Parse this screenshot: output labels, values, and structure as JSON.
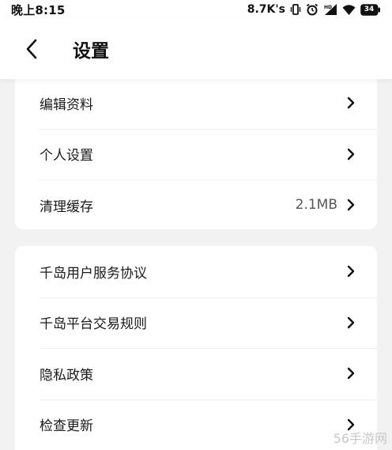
{
  "status_bar": {
    "time": "晚上8:15",
    "net_speed": "8.7K's",
    "battery_level": "34",
    "icons": [
      "vibrate-icon",
      "alarm-icon",
      "hd-signal-icon",
      "wifi-icon",
      "battery-icon"
    ]
  },
  "header": {
    "title": "设置",
    "back_icon": "chevron-left-icon"
  },
  "group_1": {
    "items": [
      {
        "label": "编辑资料",
        "value": ""
      },
      {
        "label": "个人设置",
        "value": ""
      },
      {
        "label": "清理缓存",
        "value": "2.1MB"
      }
    ]
  },
  "group_2": {
    "items": [
      {
        "label": "千岛用户服务协议",
        "value": ""
      },
      {
        "label": "千岛平台交易规则",
        "value": ""
      },
      {
        "label": "隐私政策",
        "value": ""
      },
      {
        "label": "检查更新",
        "value": ""
      }
    ]
  },
  "watermark": "56手游网",
  "colors": {
    "background": "#f2f2f2",
    "card": "#ffffff",
    "text": "#1a1a1a",
    "secondary_text": "#555555",
    "divider": "#f0f0f0"
  }
}
